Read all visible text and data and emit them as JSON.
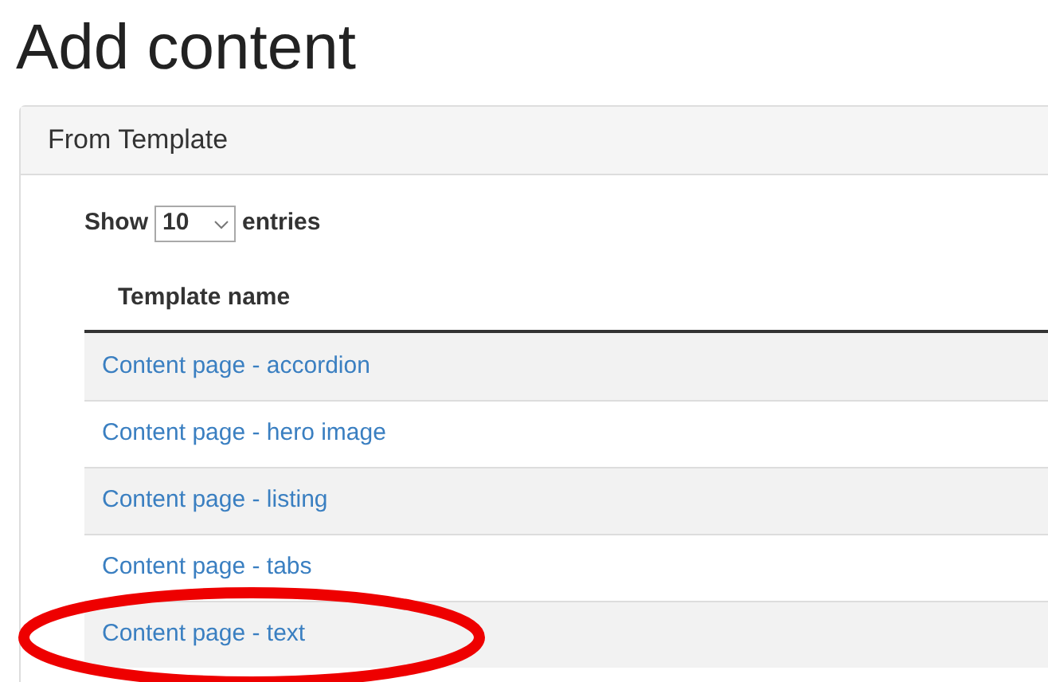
{
  "page_title": "Add content",
  "panel": {
    "title": "From Template",
    "length_control": {
      "before": "Show",
      "value": "10",
      "after": "entries"
    },
    "table": {
      "columns": [
        "Template name"
      ],
      "rows": [
        {
          "name": "Content page - accordion",
          "highlighted": false
        },
        {
          "name": "Content page - hero image",
          "highlighted": false
        },
        {
          "name": "Content page - listing",
          "highlighted": false
        },
        {
          "name": "Content page - tabs",
          "highlighted": false
        },
        {
          "name": "Content page - text",
          "highlighted": true
        }
      ]
    }
  }
}
